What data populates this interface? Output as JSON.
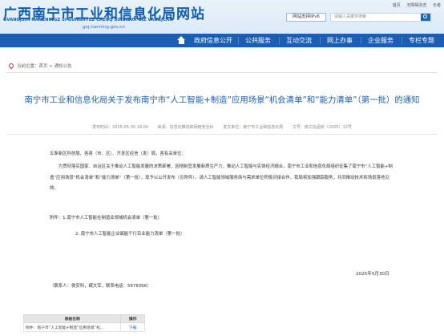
{
  "header": {
    "site_title": "广西南宁市工业和信息化局网站",
    "site_title_pinyin": "GVANGJSIH NANZNINGZ SI GUNGHYEZ CAEUQ SINSIZVA GIZ VANGJCAN",
    "site_url": "gxj.nanning.gov.cn",
    "top_links": [
      "首页",
      "无障碍浏览",
      "长者"
    ],
    "ipv6_label": "网站支持IPv6",
    "search_placeholder": "请输入关键字搜索"
  },
  "nav": {
    "items": [
      "政府信息公开",
      "公共服务",
      "互动交流",
      "网上办事",
      "企业服务",
      "专栏专题"
    ]
  },
  "breadcrumb": {
    "text": "当前位置：首页 > 通知公告"
  },
  "article": {
    "title": "南宁市工业和信息化局关于发布南宁市“人工智能+制造”应用场景“机会清单”和“能力清单”（第一批）的通知",
    "meta": {
      "publish_time": "发布时间：2025-05-30 18:00",
      "source": "来源：信息化推进和网络安全科",
      "issuer": "发文单位：南宁市工业和信息化局",
      "doc_no": "文号：南工信函安〔2025〕12号"
    },
    "salutation": "五象新区科创局、各县（市、区）、开发区经信（发）局，各有关单位：",
    "paragraph": "为贯彻落实国家、自治区关于推动人工智能发展的决策部署，因地制宜发展新质生产力，推动人工智能与实体经济融合，南宁市工业和信息化局组织征集了南宁市“人工智能+制造”应用场景“机会清单”和“能力清单”（第一批），现予以公开发布（见附件）。请人工智能领域服务商与需求单位积极对接合作，我局将加强跟踪服务，共同推动技术和场景落地见效。",
    "attachment_1": "附件：1.南宁市人工智能在制造业领域机会清单（第一批）",
    "attachment_2": "2. 南宁市人工智能企业赋能千行百业能力清单（第一批）",
    "date": "2025年5月30日",
    "contact": "（联系人：侯安科，臧文军，联系电话：5678396）"
  },
  "attachments_table": {
    "headers": [
      "表格名称",
      "操作"
    ],
    "rows": [
      {
        "name": "附件：南宁市“人工智能+制造”应用场景“机...",
        "action": "下载"
      }
    ]
  },
  "colors": {
    "brand_blue": "#1a5fb4",
    "title_blue": "#1a5fb4",
    "header_bg": "#e9f2fb"
  }
}
